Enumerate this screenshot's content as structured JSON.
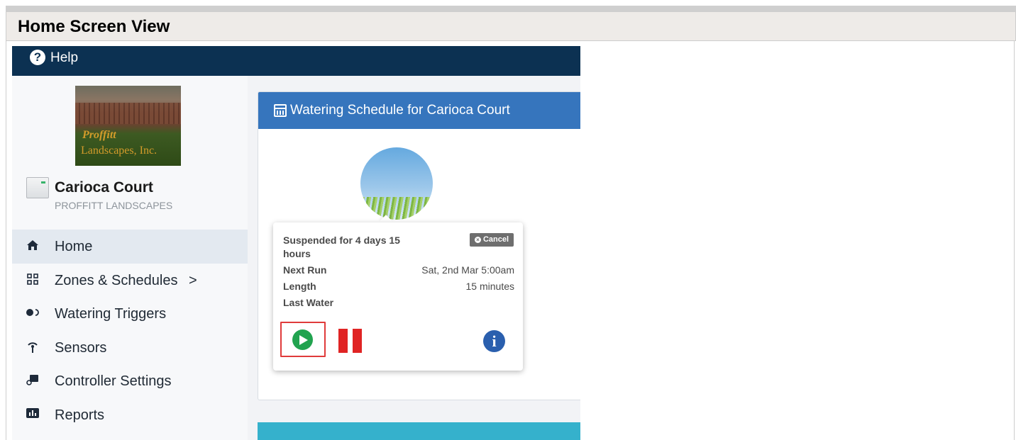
{
  "doc": {
    "title": "Home Screen View"
  },
  "topbar": {
    "help_label": "Help",
    "help_icon": "question-circle-icon"
  },
  "sidebar": {
    "logo": {
      "line1": "Proffitt",
      "line2": "Landscapes, Inc."
    },
    "controller": {
      "name": "Carioca Court",
      "company": "PROFFITT LANDSCAPES"
    },
    "nav": [
      {
        "label": "Home",
        "icon": "home-icon",
        "active": true
      },
      {
        "label": "Zones & Schedules",
        "icon": "zones-grid-icon",
        "chevron": ">"
      },
      {
        "label": "Watering Triggers",
        "icon": "toggle-icon"
      },
      {
        "label": "Sensors",
        "icon": "antenna-icon"
      },
      {
        "label": "Controller Settings",
        "icon": "controller-icon"
      },
      {
        "label": "Reports",
        "icon": "bar-chart-icon"
      }
    ]
  },
  "schedule_card": {
    "title": "Watering Schedule for Carioca Court",
    "popup": {
      "status": "Suspended for 4 days 15 hours",
      "cancel_label": "Cancel",
      "rows": [
        {
          "label": "Next Run",
          "value": "Sat, 2nd Mar 5:00am"
        },
        {
          "label": "Length",
          "value": "15 minutes"
        },
        {
          "label": "Last Water",
          "value": ""
        }
      ]
    }
  },
  "colors": {
    "topbar": "#0c3152",
    "card_header": "#3675bd",
    "play": "#21a34f",
    "pause": "#e02424",
    "info": "#2a5fae",
    "highlight": "#e03b3b",
    "next_card": "#35b1cc"
  }
}
